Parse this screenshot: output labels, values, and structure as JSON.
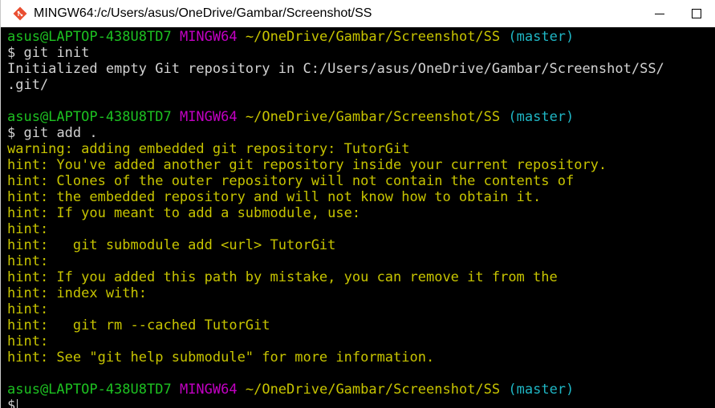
{
  "window": {
    "title": "MINGW64:/c/Users/asus/OneDrive/Gambar/Screenshot/SS",
    "icon": "git-bash-icon"
  },
  "prompt": {
    "user_host": "asus@LAPTOP-438U8TD7",
    "shell": "MINGW64",
    "path": "~/OneDrive/Gambar/Screenshot/SS",
    "branch": "(master)",
    "symbol": "$"
  },
  "blocks": [
    {
      "command": "git init",
      "output": [
        "Initialized empty Git repository in C:/Users/asus/OneDrive/Gambar/Screenshot/SS/",
        ".git/"
      ]
    },
    {
      "command": "git add .",
      "output": [
        "warning: adding embedded git repository: TutorGit",
        "hint: You've added another git repository inside your current repository.",
        "hint: Clones of the outer repository will not contain the contents of",
        "hint: the embedded repository and will not know how to obtain it.",
        "hint: If you meant to add a submodule, use:",
        "hint:",
        "hint:   git submodule add <url> TutorGit",
        "hint:",
        "hint: If you added this path by mistake, you can remove it from the",
        "hint: index with:",
        "hint:",
        "hint:   git rm --cached TutorGit",
        "hint:",
        "hint: See \"git help submodule\" for more information."
      ]
    }
  ],
  "colors": {
    "user_host": "#1dc121",
    "shell": "#c200c2",
    "path": "#c7c400",
    "branch": "#1fb6c4",
    "output": "#d2d2d2",
    "background": "#000000"
  }
}
